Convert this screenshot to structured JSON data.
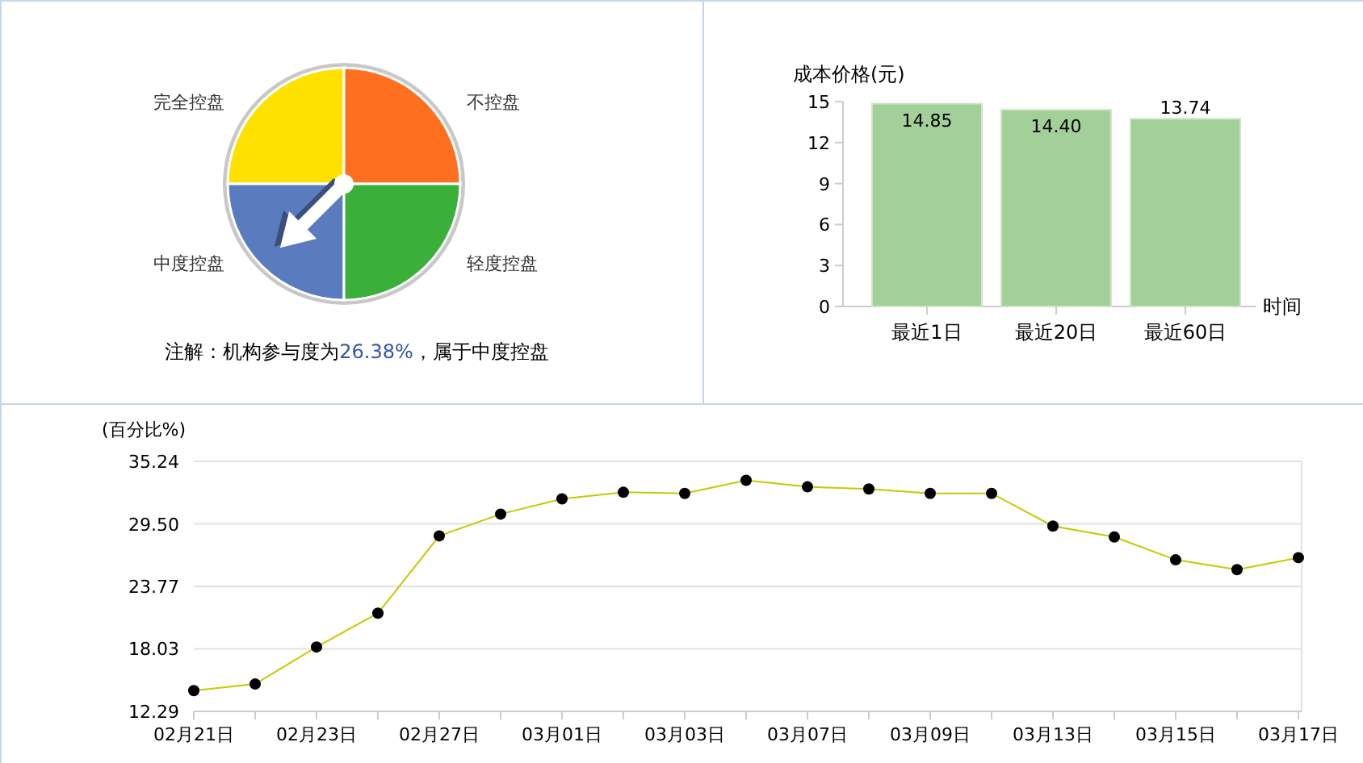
{
  "gauge": {
    "quadrants": [
      {
        "label": "完全控盘",
        "color": "#ffe100",
        "selected": false
      },
      {
        "label": "不控盘",
        "color": "#ff6f20",
        "selected": false
      },
      {
        "label": "中度控盘",
        "color": "#5a7bbd",
        "selected": true
      },
      {
        "label": "轻度控盘",
        "color": "#3aaf3a",
        "selected": false
      }
    ],
    "note": {
      "prefix": "注解：机构参与度为",
      "value": "26.38%",
      "suffix": "，属于中度控盘"
    }
  },
  "cost_chart": {
    "chart_data": {
      "type": "bar",
      "ylabel": "成本价格(元)",
      "xlabel": "时间",
      "categories": [
        "最近1日",
        "最近20日",
        "最近60日"
      ],
      "series": [
        {
          "color": "#a3cf99",
          "values": [
            14.85,
            14.4,
            13.74
          ]
        }
      ],
      "value_labels": [
        "14.85",
        "14.40",
        "13.74"
      ],
      "ylim": [
        0,
        15
      ],
      "yticks": [
        0,
        3,
        6,
        9,
        12,
        15
      ]
    }
  },
  "ratio_chart": {
    "chart_data": {
      "type": "line",
      "ylabel": "(百分比%)",
      "categories": [
        "02月21日",
        null,
        "02月23日",
        null,
        "02月27日",
        null,
        "03月01日",
        null,
        "03月03日",
        null,
        "03月07日",
        null,
        "03月09日",
        null,
        "03月13日",
        null,
        "03月15日",
        null,
        "03月17日"
      ],
      "series": [
        {
          "color": "#c8c800",
          "marker": "circle",
          "values": [
            14.2,
            14.8,
            18.2,
            21.3,
            28.4,
            30.4,
            31.8,
            32.4,
            32.3,
            33.5,
            32.9,
            32.7,
            32.3,
            32.3,
            29.3,
            28.3,
            26.2,
            25.3,
            26.4
          ]
        }
      ],
      "ylim": [
        12.29,
        35.24
      ],
      "yticks": [
        {
          "value": 12.29,
          "label": "12.29"
        },
        {
          "value": 18.03,
          "label": "18.03"
        },
        {
          "value": 23.77,
          "label": "23.77"
        },
        {
          "value": 29.5,
          "label": "29.50"
        },
        {
          "value": 35.24,
          "label": "35.24"
        }
      ],
      "grid": true
    }
  }
}
